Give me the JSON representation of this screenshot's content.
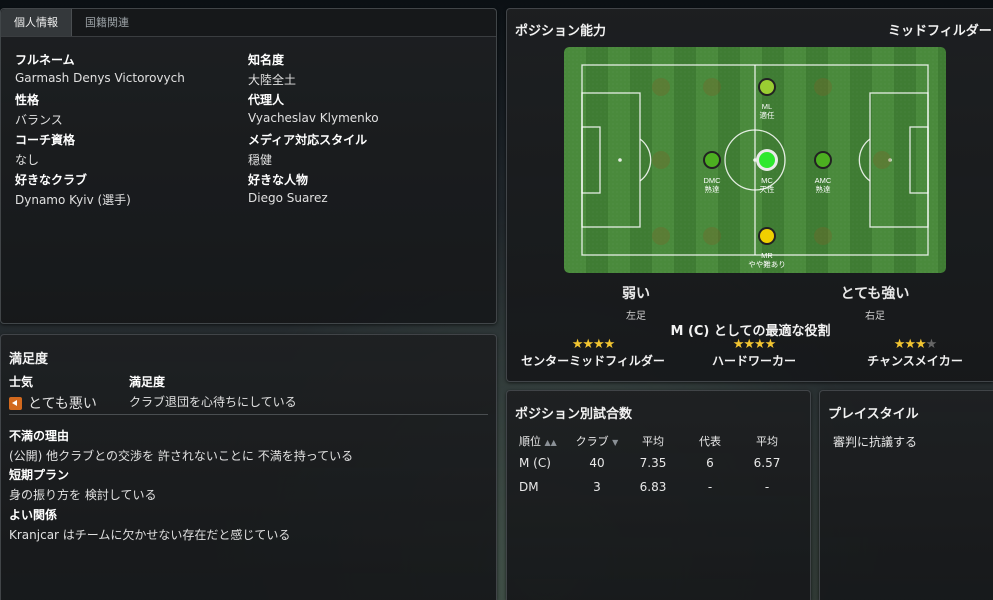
{
  "tabs": [
    "個人情報",
    "国籍関連"
  ],
  "personal": {
    "fields": [
      {
        "label": "フルネーム",
        "value": "Garmash Denys Victorovych"
      },
      {
        "label": "知名度",
        "value": "大陸全土"
      },
      {
        "label": "性格",
        "value": "バランス"
      },
      {
        "label": "代理人",
        "value": "Vyacheslav Klymenko"
      },
      {
        "label": "コーチ資格",
        "value": "なし"
      },
      {
        "label": "メディア対応スタイル",
        "value": "穏健"
      },
      {
        "label": "好きなクラブ",
        "value": "Dynamo Kyiv (選手)"
      },
      {
        "label": "好きな人物",
        "value": "Diego Suarez"
      }
    ]
  },
  "position": {
    "title": "ポジション能力",
    "main_position": "ミッドフィルダー",
    "pitch_markers": [
      {
        "code": "ML",
        "rating": "適任",
        "color": "#9acd32"
      },
      {
        "code": "DMC",
        "rating": "熟達",
        "color": "#4caf20"
      },
      {
        "code": "MC",
        "rating": "天性",
        "color": "#2ee82e"
      },
      {
        "code": "AMC",
        "rating": "熟達",
        "color": "#4caf20"
      },
      {
        "code": "MR",
        "rating": "やや難あり",
        "color": "#f0d000"
      }
    ],
    "weak": {
      "label": "弱い",
      "foot": "左足"
    },
    "strong": {
      "label": "とても強い",
      "foot": "右足"
    },
    "best_role_title": "M (C) としての最適な役割",
    "roles": [
      {
        "name": "センターミッドフィルダー",
        "stars": 4,
        "max": 4
      },
      {
        "name": "ハードワーカー",
        "stars": 4,
        "max": 4
      },
      {
        "name": "チャンスメイカー",
        "stars": 3.5,
        "max": 4
      }
    ]
  },
  "satisfaction": {
    "title": "満足度",
    "morale_label": "士気",
    "morale_value": "とても悪い",
    "satisfaction_label": "満足度",
    "satisfaction_value": "クラブ退団を心待ちにしている",
    "reason_label": "不満の理由",
    "reason_value": "(公開) 他クラブとの交渉を 許されないことに 不満を持っている",
    "plan_label": "短期プラン",
    "plan_value": "身の振り方を 検討している",
    "relation_label": "よい関係",
    "relation_value": "Kranjcar はチームに欠かせない存在だと感じている"
  },
  "stats": {
    "title": "ポジション別試合数",
    "headers": [
      "順位",
      "クラブ",
      "平均",
      "代表",
      "平均"
    ],
    "rows": [
      [
        "M (C)",
        "40",
        "7.35",
        "6",
        "6.57"
      ],
      [
        "DM",
        "3",
        "6.83",
        "-",
        "-"
      ]
    ]
  },
  "playstyle": {
    "title": "プレイスタイル",
    "items": [
      "審判に抗議する"
    ]
  }
}
